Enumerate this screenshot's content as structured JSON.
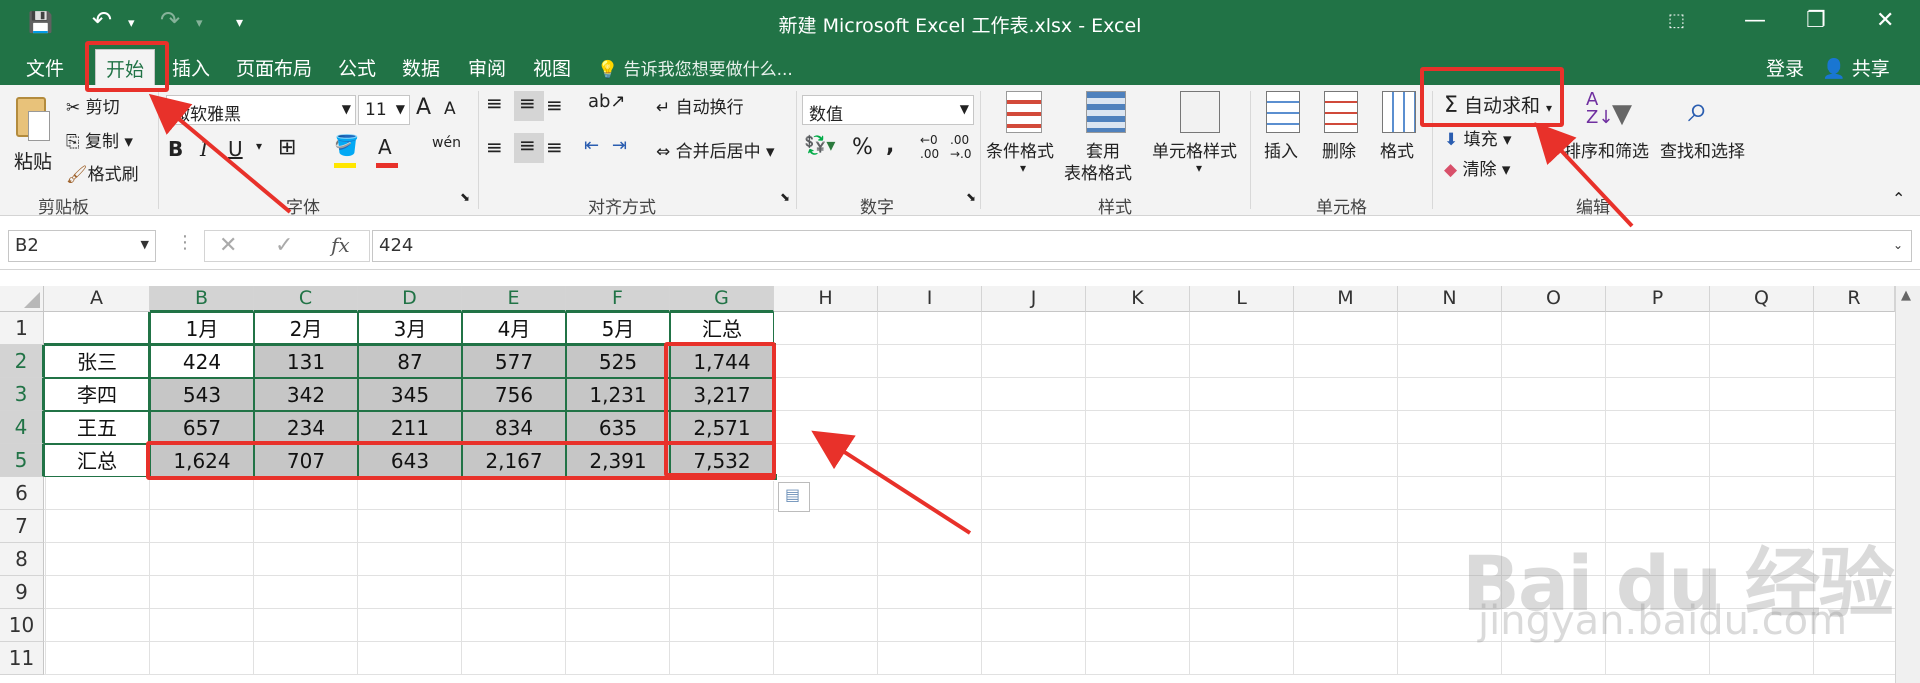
{
  "window": {
    "title": "新建 Microsoft Excel 工作表.xlsx - Excel"
  },
  "quick_access": {
    "save": "💾",
    "undo": "↶",
    "redo": "↷",
    "customize": "▾"
  },
  "window_controls": {
    "ribbon_display": "⬚",
    "minimize": "—",
    "restore": "❐",
    "close": "✕"
  },
  "tabs": [
    {
      "label": "文件"
    },
    {
      "label": "开始"
    },
    {
      "label": "插入"
    },
    {
      "label": "页面布局"
    },
    {
      "label": "公式"
    },
    {
      "label": "数据"
    },
    {
      "label": "审阅"
    },
    {
      "label": "视图"
    }
  ],
  "tell_me": "告诉我您想要做什么...",
  "account": {
    "login": "登录",
    "share": "共享"
  },
  "ribbon": {
    "clipboard": {
      "paste": "粘贴",
      "cut": "剪切",
      "copy": "复制",
      "format_painter": "格式刷",
      "group": "剪贴板"
    },
    "font": {
      "name": "微软雅黑",
      "size": "11",
      "grow": "A",
      "shrink": "A",
      "bold": "B",
      "italic": "I",
      "underline": "U",
      "phonetic": "wén",
      "group": "字体"
    },
    "alignment": {
      "wrap": "自动换行",
      "merge": "合并后居中",
      "group": "对齐方式"
    },
    "number": {
      "format": "数值",
      "percent": "%",
      "comma": ",",
      "group": "数字"
    },
    "styles": {
      "conditional": "条件格式",
      "table1": "套用",
      "table2": "表格格式",
      "cell_styles": "单元格样式",
      "group": "样式"
    },
    "cells": {
      "insert": "插入",
      "delete": "删除",
      "format": "格式",
      "group": "单元格"
    },
    "editing": {
      "autosum": "自动求和",
      "fill": "填充",
      "clear": "清除",
      "sort": "排序和筛选",
      "find": "查找和选择",
      "group": "编辑"
    }
  },
  "formula_bar": {
    "name_box": "B2",
    "fx": "fx",
    "content": "424"
  },
  "sheet": {
    "columns": [
      "A",
      "B",
      "C",
      "D",
      "E",
      "F",
      "G",
      "H",
      "I",
      "J",
      "K",
      "L",
      "M",
      "N",
      "O",
      "P",
      "Q",
      "R"
    ],
    "rows": [
      "1",
      "2",
      "3",
      "4",
      "5",
      "6",
      "7",
      "8",
      "9",
      "10",
      "11"
    ],
    "cells": [
      [
        "",
        "1月",
        "2月",
        "3月",
        "4月",
        "5月",
        "汇总"
      ],
      [
        "张三",
        "424",
        "131",
        "87",
        "577",
        "525",
        "1,744"
      ],
      [
        "李四",
        "543",
        "342",
        "345",
        "756",
        "1,231",
        "3,217"
      ],
      [
        "王五",
        "657",
        "234",
        "211",
        "834",
        "635",
        "2,571"
      ],
      [
        "汇总",
        "1,624",
        "707",
        "643",
        "2,167",
        "2,391",
        "7,532"
      ]
    ]
  },
  "watermark": {
    "brand": "Bai du 经验",
    "url": "jingyan.baidu.com"
  }
}
